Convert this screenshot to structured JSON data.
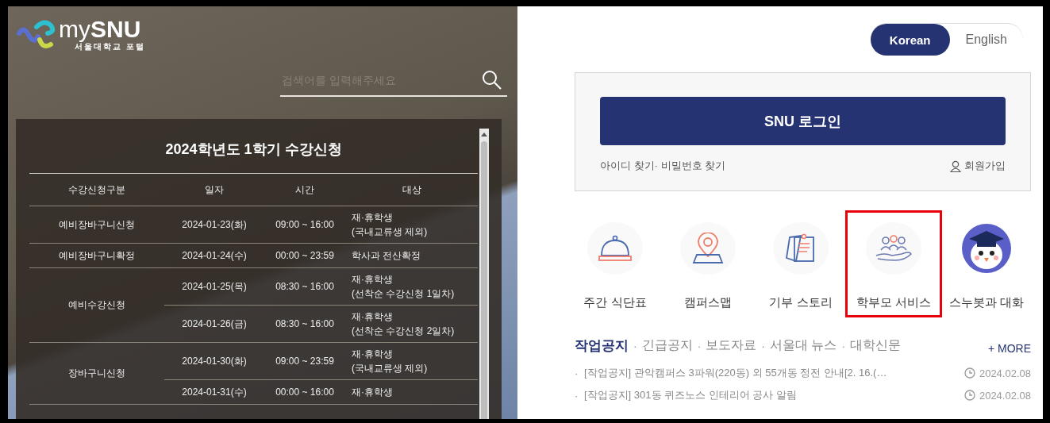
{
  "logo": {
    "text": "my**SNU**",
    "subtitle": "서울대학교 포털"
  },
  "search": {
    "placeholder": "검색어를 입력해주세요"
  },
  "schedule": {
    "title": "2024학년도 1학기 수강신청",
    "columns": [
      "수강신청구분",
      "일자",
      "시간",
      "대상"
    ],
    "groups": [
      {
        "category": "예비장바구니신청",
        "rows": [
          {
            "date": "2024-01-23(화)",
            "time": "09:00 ~ 16:00",
            "target": [
              "재·휴학생",
              "(국내교류생 제외)"
            ]
          }
        ]
      },
      {
        "category": "예비장바구니확정",
        "rows": [
          {
            "date": "2024-01-24(수)",
            "time": "00:00 ~ 23:59",
            "target": [
              "학사과 전산확정"
            ]
          }
        ]
      },
      {
        "category": "예비수강신청",
        "rows": [
          {
            "date": "2024-01-25(목)",
            "time": "08:30 ~ 16:00",
            "target": [
              "재·휴학생",
              "(선착순 수강신청 1일차)"
            ]
          },
          {
            "date": "2024-01-26(금)",
            "time": "08:30 ~ 16:00",
            "target": [
              "재·휴학생",
              "(선착순 수강신청 2일차)"
            ]
          }
        ]
      },
      {
        "category": "장바구니신청",
        "rows": [
          {
            "date": "2024-01-30(화)",
            "time": "09:00 ~ 23:59",
            "target": [
              "재·휴학생",
              "(국내교류생 제외)"
            ]
          },
          {
            "date": "2024-01-31(수)",
            "time": "00:00 ~ 16:00",
            "target": [
              "재·휴학생"
            ]
          }
        ]
      }
    ]
  },
  "language": [
    {
      "label": "Korean",
      "selected": true
    },
    {
      "label": "English",
      "selected": false
    }
  ],
  "login": {
    "button": "SNU 로그인",
    "find_links": "아이디 찾기· 비밀번호 찾기",
    "signup": "회원가입"
  },
  "quick_links": [
    {
      "label": "주간 식단표",
      "highlighted": false
    },
    {
      "label": "캠퍼스맵",
      "highlighted": false
    },
    {
      "label": "기부 스토리",
      "highlighted": false
    },
    {
      "label": "학부모 서비스",
      "highlighted": true
    },
    {
      "label": "스누봇과 대화",
      "highlighted": false
    }
  ],
  "notice_tabs": [
    {
      "label": "작업공지",
      "selected": true
    },
    {
      "label": "긴급공지",
      "selected": false
    },
    {
      "label": "보도자료",
      "selected": false
    },
    {
      "label": "서울대 뉴스",
      "selected": false
    },
    {
      "label": "대학신문",
      "selected": false
    }
  ],
  "tab_separator": "·",
  "more": "+ MORE",
  "notice_bullet": "·",
  "notices": [
    {
      "title": "[작업공지] 관악캠퍼스 3파워(220동) 외 55개동 정전 안내[2. 16.(…",
      "date": "2024.02.08"
    },
    {
      "title": "[작업공지] 301동 퀴즈노스 인테리어 공사 알림",
      "date": "2024.02.08"
    }
  ]
}
